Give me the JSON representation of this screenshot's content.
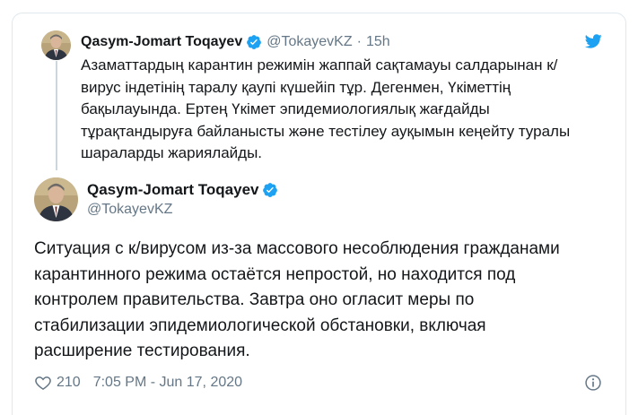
{
  "parent_tweet": {
    "author_name": "Qasym-Jomart Toqayev",
    "handle": "@TokayevKZ",
    "separator": "·",
    "time": "15h",
    "text": "Азаматтардың карантин режимін жаппай сақтамауы салдарынан к/\nвирус індетінің таралу қаупі күшейіп тұр. Дегенмен, Үкіметтің\nбақылауында. Ертең Үкімет эпидемиологиялық жағдайды\nтұрақтандыруға байланысты және тестілеу ауқымын кеңейту туралы\nшараларды жариялайды."
  },
  "main_tweet": {
    "author_name": "Qasym-Jomart Toqayev",
    "handle": "@TokayevKZ",
    "text": "Ситуация с к/вирусом из-за массового несоблюдения гражданами\nкарантинного режима остаётся непростой, но находится под\nконтролем правительства. Завтра оно огласит меры по\nстабилизации эпидемиологической обстановки, включая\nрасширение тестирования.",
    "like_count": "210",
    "timestamp": "7:05 PM - Jun 17, 2020"
  },
  "icons": {
    "verified": "verified-badge-icon",
    "brand": "twitter-bird-icon",
    "like": "heart-icon",
    "info": "info-icon"
  },
  "colors": {
    "brand_blue": "#1da1f2",
    "secondary_text": "#657786",
    "border": "#e1e8ed"
  }
}
